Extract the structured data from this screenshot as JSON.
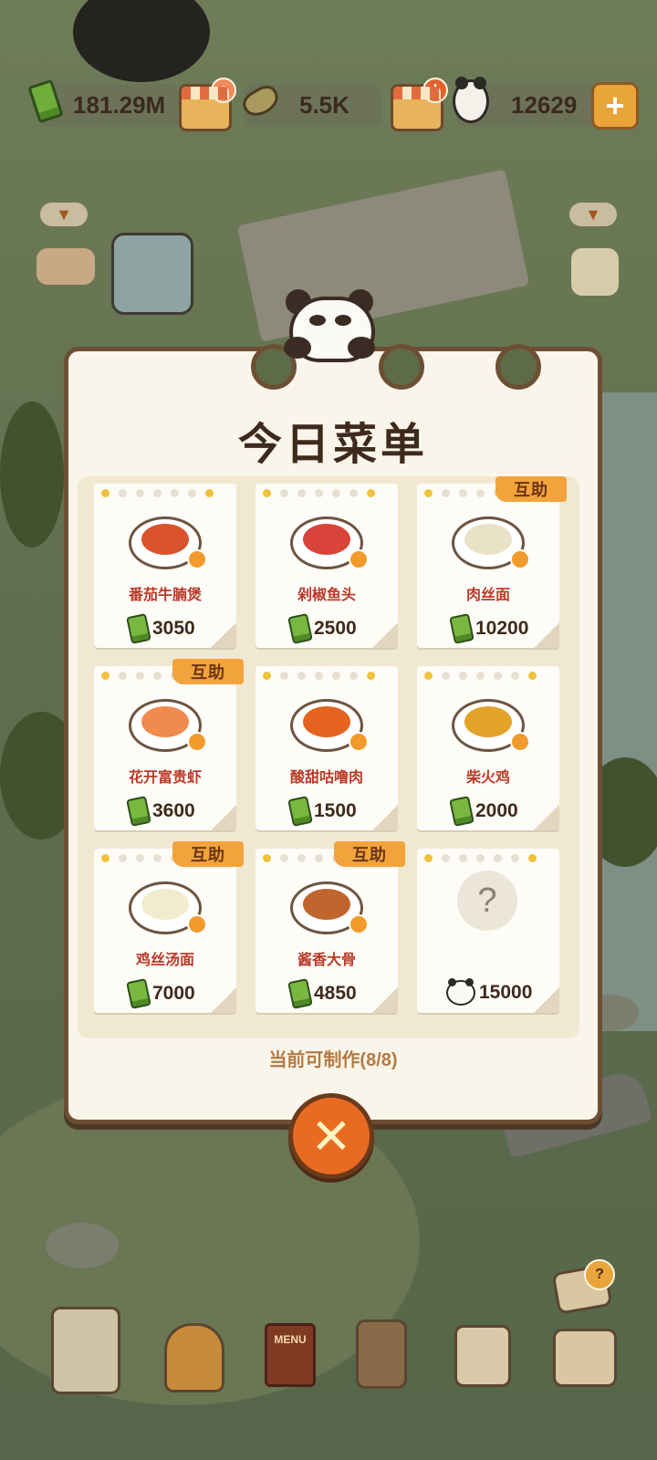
{
  "resources": {
    "bamboo_amount": "181.29M",
    "bamboo_shoot_amount": "5.5K",
    "panda_coin_amount": "12629",
    "shop1_badge": "+",
    "shop2_badge": "!",
    "add_label": "+"
  },
  "menu": {
    "title": "今日菜单",
    "status_text": "当前可制作(8/8)",
    "help_tag": "互助",
    "close_label": "✕",
    "dishes": [
      {
        "name": "番茄牛腩煲",
        "price": "3050",
        "tag": "",
        "food_color": "#d9532b"
      },
      {
        "name": "剁椒鱼头",
        "price": "2500",
        "tag": "",
        "food_color": "#d8443a"
      },
      {
        "name": "肉丝面",
        "price": "10200",
        "tag": "互助",
        "food_color": "#e9e2c6"
      },
      {
        "name": "花开富贵虾",
        "price": "3600",
        "tag": "互助",
        "food_color": "#f08a4d"
      },
      {
        "name": "酸甜咕噜肉",
        "price": "1500",
        "tag": "",
        "food_color": "#e4631f"
      },
      {
        "name": "柴火鸡",
        "price": "2000",
        "tag": "",
        "food_color": "#e3a22a"
      },
      {
        "name": "鸡丝汤面",
        "price": "7000",
        "tag": "互助",
        "food_color": "#f1ecd0"
      },
      {
        "name": "酱香大骨",
        "price": "4850",
        "tag": "互助",
        "food_color": "#c0652e"
      }
    ],
    "locked": {
      "symbol": "?",
      "price": "15000",
      "currency_icon": "panda-coin"
    }
  },
  "toolbar": {
    "menu_book_label": "MENU"
  }
}
